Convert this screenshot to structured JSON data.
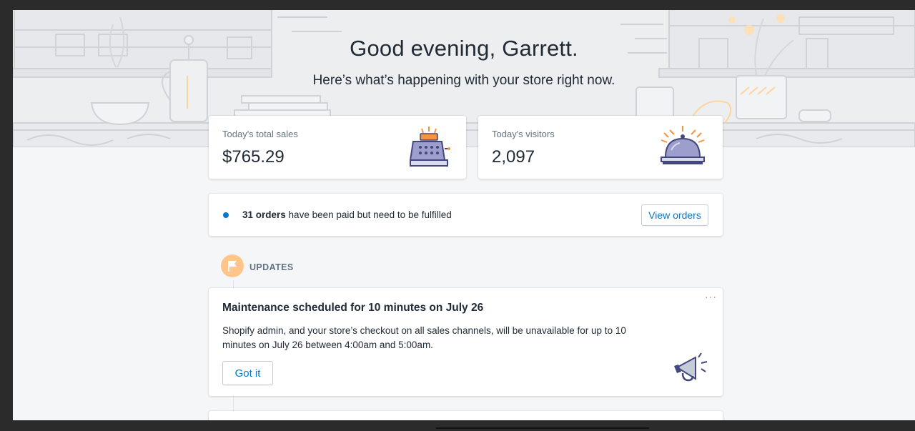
{
  "header": {
    "greeting": "Good evening, Garrett.",
    "subtitle": "Here’s what’s happening with your store right now."
  },
  "stats": {
    "sales": {
      "label": "Today's total sales",
      "value": "$765.29",
      "icon": "cash-register-icon"
    },
    "visitors": {
      "label": "Today's visitors",
      "value": "2,097",
      "icon": "service-bell-icon"
    }
  },
  "orders": {
    "count": "31 orders",
    "message": " have been paid but need to be fulfilled",
    "button_label": "View orders",
    "dot_color": "#007ace"
  },
  "updates": {
    "section_label": "UPDATES",
    "badge_icon": "flag-icon",
    "badge_color": "#ffc58b",
    "items": [
      {
        "title": "Maintenance scheduled for 10 minutes on July 26",
        "body": "Shopify admin, and your store’s checkout on all sales channels, will be unavailable for up to 10 minutes on July 26 between 4:00am and 5:00am.",
        "button_label": "Got it",
        "more_label": "···",
        "icon": "megaphone-icon"
      }
    ]
  },
  "colors": {
    "link": "#007ace",
    "page_bg": "#f4f6f8",
    "hero_bg": "#edeef0",
    "text": "#212b36",
    "subdued": "#637381"
  }
}
